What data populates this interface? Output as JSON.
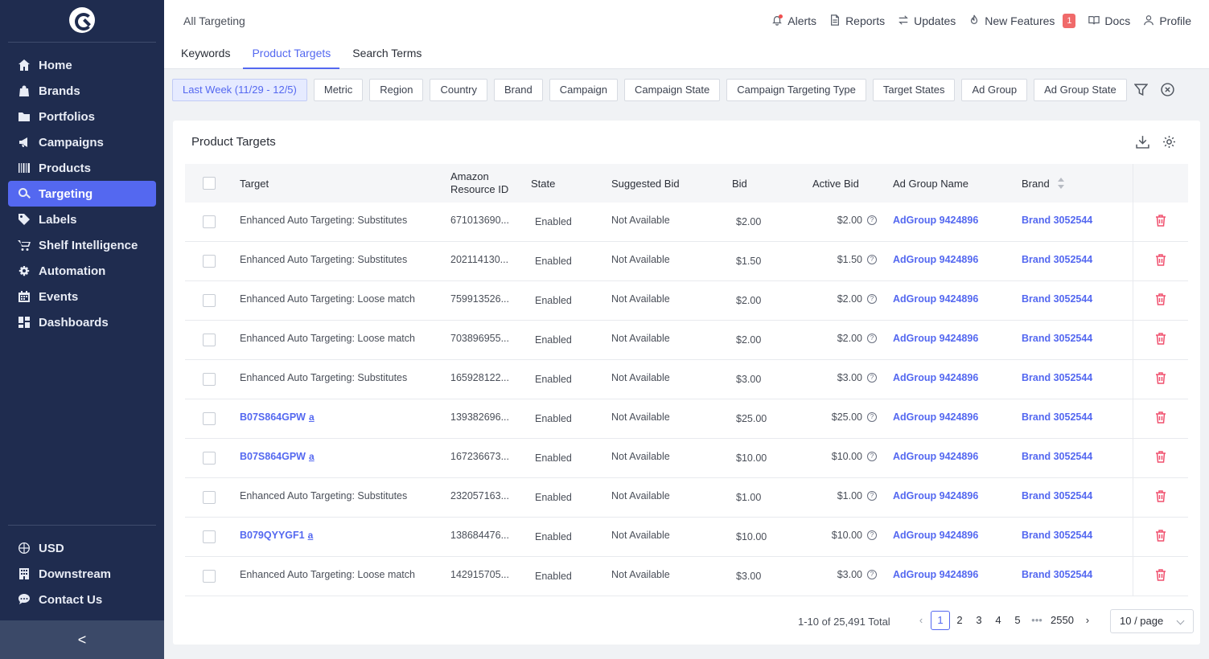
{
  "sidebar": {
    "nav": [
      {
        "label": "Home",
        "icon": "home-icon"
      },
      {
        "label": "Brands",
        "icon": "bag-icon"
      },
      {
        "label": "Portfolios",
        "icon": "folder-icon"
      },
      {
        "label": "Campaigns",
        "icon": "megaphone-icon"
      },
      {
        "label": "Products",
        "icon": "barcode-icon"
      },
      {
        "label": "Targeting",
        "icon": "target-search-icon",
        "active": true
      },
      {
        "label": "Labels",
        "icon": "tag-icon"
      },
      {
        "label": "Shelf Intelligence",
        "icon": "cart-icon"
      },
      {
        "label": "Automation",
        "icon": "gear-icon"
      },
      {
        "label": "Events",
        "icon": "calendar-icon"
      },
      {
        "label": "Dashboards",
        "icon": "grid-icon"
      }
    ],
    "bottom": [
      {
        "label": "USD",
        "icon": "globe-icon"
      },
      {
        "label": "Downstream",
        "icon": "building-icon"
      },
      {
        "label": "Contact Us",
        "icon": "chat-icon"
      }
    ],
    "collapse": "<"
  },
  "header": {
    "title": "All Targeting",
    "links": {
      "alerts": "Alerts",
      "reports": "Reports",
      "updates": "Updates",
      "new_features": "New Features",
      "new_features_badge": "1",
      "docs": "Docs",
      "profile": "Profile"
    },
    "tabs": [
      "Keywords",
      "Product Targets",
      "Search Terms"
    ],
    "active_tab": "Product Targets"
  },
  "filters": [
    "Last Week (11/29 - 12/5)",
    "Metric",
    "Region",
    "Country",
    "Brand",
    "Campaign",
    "Campaign State",
    "Campaign Targeting Type",
    "Target States",
    "Ad Group",
    "Ad Group State"
  ],
  "card": {
    "title": "Product Targets",
    "columns": {
      "target": "Target",
      "resource_id_1": "Amazon",
      "resource_id_2": "Resource ID",
      "state": "State",
      "suggested_bid": "Suggested Bid",
      "bid": "Bid",
      "active_bid": "Active Bid",
      "ad_group": "Ad Group Name",
      "brand": "Brand"
    },
    "rows": [
      {
        "target": "Enhanced Auto Targeting: Substitutes",
        "asin": false,
        "resource_id": "671013690...",
        "state": "Enabled",
        "suggested_bid": "Not Available",
        "bid": "$2.00",
        "active_bid": "$2.00",
        "ad_group": "AdGroup 9424896",
        "brand": "Brand 3052544"
      },
      {
        "target": "Enhanced Auto Targeting: Substitutes",
        "asin": false,
        "resource_id": "202114130...",
        "state": "Enabled",
        "suggested_bid": "Not Available",
        "bid": "$1.50",
        "active_bid": "$1.50",
        "ad_group": "AdGroup 9424896",
        "brand": "Brand 3052544"
      },
      {
        "target": "Enhanced Auto Targeting: Loose match",
        "asin": false,
        "resource_id": "759913526...",
        "state": "Enabled",
        "suggested_bid": "Not Available",
        "bid": "$2.00",
        "active_bid": "$2.00",
        "ad_group": "AdGroup 9424896",
        "brand": "Brand 3052544"
      },
      {
        "target": "Enhanced Auto Targeting: Loose match",
        "asin": false,
        "resource_id": "703896955...",
        "state": "Enabled",
        "suggested_bid": "Not Available",
        "bid": "$2.00",
        "active_bid": "$2.00",
        "ad_group": "AdGroup 9424896",
        "brand": "Brand 3052544"
      },
      {
        "target": "Enhanced Auto Targeting: Substitutes",
        "asin": false,
        "resource_id": "165928122...",
        "state": "Enabled",
        "suggested_bid": "Not Available",
        "bid": "$3.00",
        "active_bid": "$3.00",
        "ad_group": "AdGroup 9424896",
        "brand": "Brand 3052544"
      },
      {
        "target": "B07S864GPW",
        "asin": true,
        "resource_id": "139382696...",
        "state": "Enabled",
        "suggested_bid": "Not Available",
        "bid": "$25.00",
        "active_bid": "$25.00",
        "ad_group": "AdGroup 9424896",
        "brand": "Brand 3052544"
      },
      {
        "target": "B07S864GPW",
        "asin": true,
        "resource_id": "167236673...",
        "state": "Enabled",
        "suggested_bid": "Not Available",
        "bid": "$10.00",
        "active_bid": "$10.00",
        "ad_group": "AdGroup 9424896",
        "brand": "Brand 3052544"
      },
      {
        "target": "Enhanced Auto Targeting: Substitutes",
        "asin": false,
        "resource_id": "232057163...",
        "state": "Enabled",
        "suggested_bid": "Not Available",
        "bid": "$1.00",
        "active_bid": "$1.00",
        "ad_group": "AdGroup 9424896",
        "brand": "Brand 3052544"
      },
      {
        "target": "B079QYYGF1",
        "asin": true,
        "resource_id": "138684476...",
        "state": "Enabled",
        "suggested_bid": "Not Available",
        "bid": "$10.00",
        "active_bid": "$10.00",
        "ad_group": "AdGroup 9424896",
        "brand": "Brand 3052544"
      },
      {
        "target": "Enhanced Auto Targeting: Loose match",
        "asin": false,
        "resource_id": "142915705...",
        "state": "Enabled",
        "suggested_bid": "Not Available",
        "bid": "$3.00",
        "active_bid": "$3.00",
        "ad_group": "AdGroup 9424896",
        "brand": "Brand 3052544"
      }
    ]
  },
  "pagination": {
    "total_text": "1-10 of 25,491 Total",
    "pages": [
      "1",
      "2",
      "3",
      "4",
      "5"
    ],
    "ellipsis": "•••",
    "last_page": "2550",
    "current": "1",
    "page_size": "10 / page"
  },
  "colors": {
    "accent": "#5468f0",
    "sidebar": "#1f2c4f",
    "delete": "#f0506e",
    "badge": "#f06a6a"
  }
}
